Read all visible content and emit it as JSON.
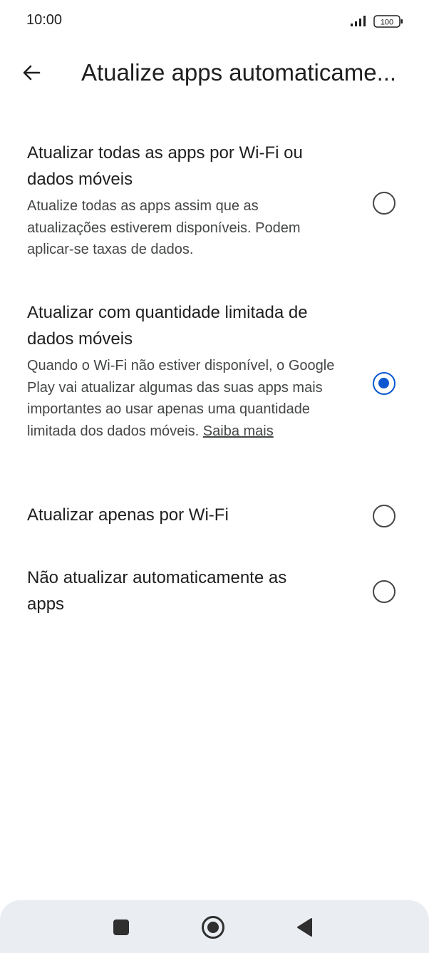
{
  "status_bar": {
    "time": "10:00",
    "battery": "100",
    "signal_icon": "signal-icon",
    "battery_icon": "battery-icon"
  },
  "app_bar": {
    "back_icon": "arrow-back-icon",
    "title": "Atualize apps automaticame..."
  },
  "options": [
    {
      "title": "Atualizar todas as apps por Wi-Fi ou dados móveis",
      "description": "Atualize todas as apps assim que as atualizações estiverem disponíveis. Podem aplicar-se taxas de dados.",
      "selected": false
    },
    {
      "title": "Atualizar com quantidade limitada de dados móveis",
      "description": "Quando o Wi-Fi não estiver disponível, o Google Play vai atualizar algumas das suas apps mais importantes ao usar apenas uma quantidade limitada dos dados móveis.",
      "link": "Saiba mais",
      "selected": true
    },
    {
      "title": "Atualizar apenas por Wi-Fi",
      "selected": false
    },
    {
      "title": "Não atualizar automaticamente as apps",
      "selected": false
    }
  ],
  "nav_bar": {
    "recents_icon": "square-recents-icon",
    "home_icon": "circle-home-icon",
    "back_icon": "triangle-back-icon"
  },
  "colors": {
    "accent": "#0b57d0",
    "nav_background": "#eaedf2"
  }
}
